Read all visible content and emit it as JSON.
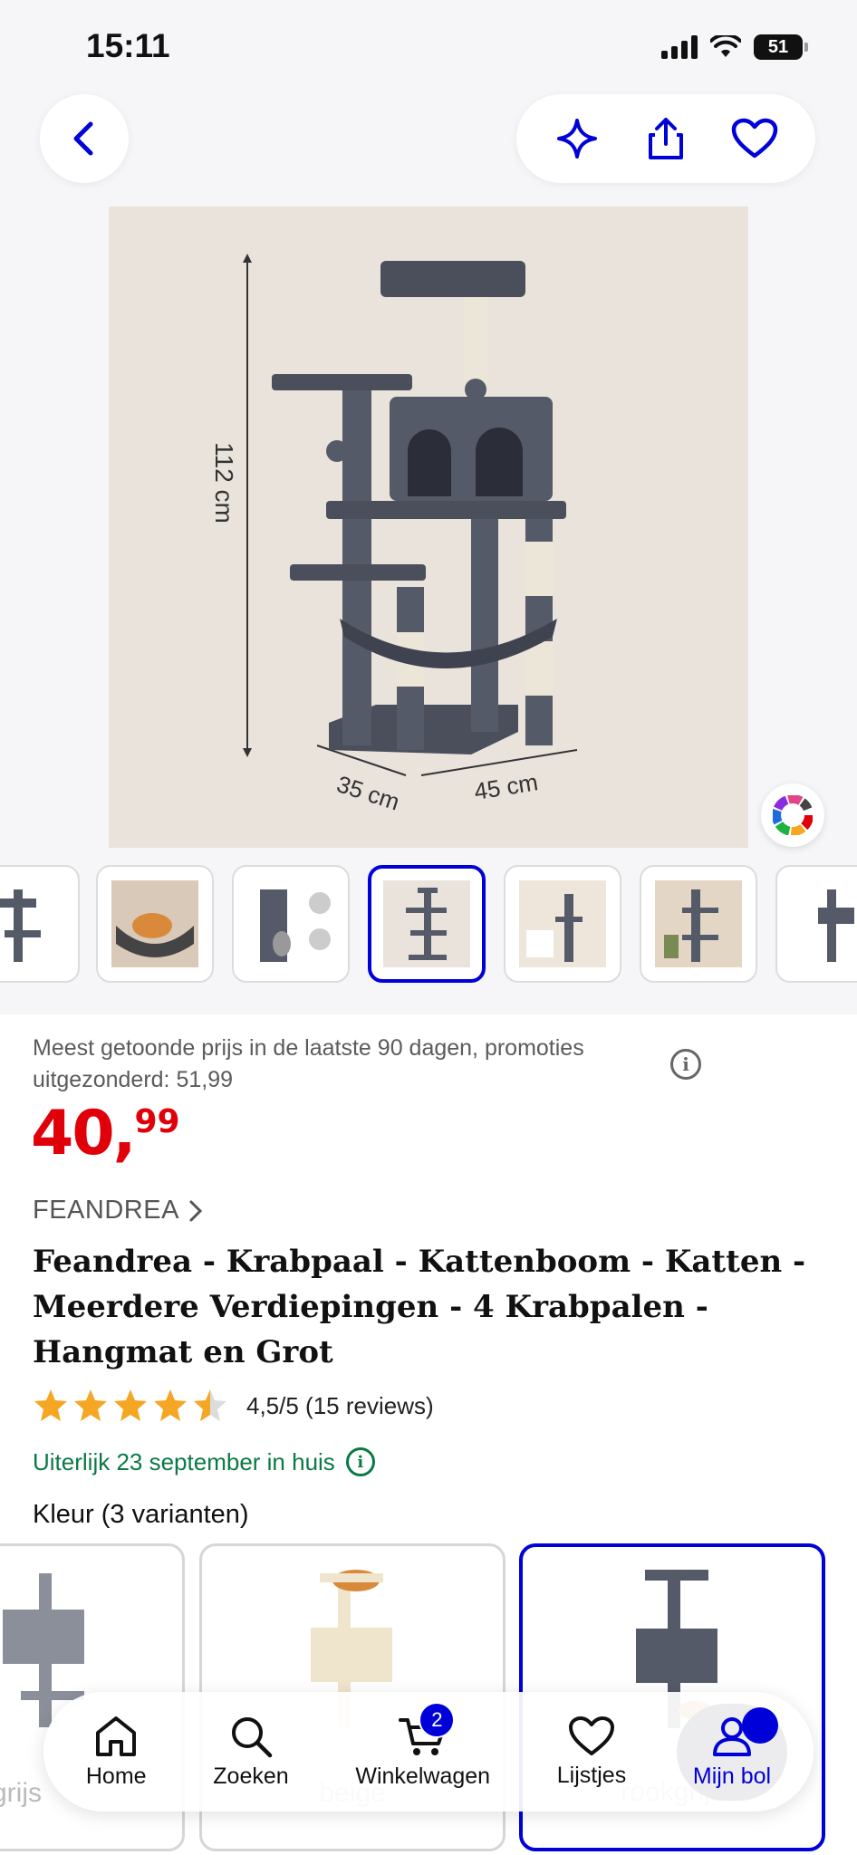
{
  "status_bar": {
    "time": "15:11",
    "battery": "51"
  },
  "nav": {
    "back_icon": "chevron-left-icon",
    "actions": [
      "sparkle-icon",
      "share-icon",
      "heart-icon"
    ]
  },
  "product_image": {
    "height_label": "112 cm",
    "depth_label": "35 cm",
    "width_label": "45 cm"
  },
  "thumbnails": {
    "count": 7,
    "active_index": 3
  },
  "price_block": {
    "note": "Meest getoonde prijs in de laatste 90 dagen, promoties uitgezonderd: 51,99",
    "price_euros": "40,",
    "price_cents": "99"
  },
  "product": {
    "brand": "FEANDREA",
    "title": "Feandrea - Krabpaal - Kattenboom - Katten - Meerdere Verdiepingen - 4 Krabpalen - Hangmat en Grot",
    "rating_value": 4.5,
    "rating_text": "4,5/5 (15 reviews)",
    "delivery": "Uiterlijk 23 september in huis"
  },
  "variants": {
    "label": "Kleur (3 varianten)",
    "items": [
      {
        "name": "grijs"
      },
      {
        "name": "beige"
      },
      {
        "name": "rookgrijs"
      }
    ]
  },
  "tabbar": {
    "items": [
      {
        "label": "Home",
        "icon": "home-icon"
      },
      {
        "label": "Zoeken",
        "icon": "search-icon"
      },
      {
        "label": "Winkelwagen",
        "icon": "cart-icon",
        "badge": "2"
      },
      {
        "label": "Lijstjes",
        "icon": "heart-icon"
      },
      {
        "label": "Mijn bol",
        "icon": "user-icon",
        "active": true
      }
    ]
  },
  "colors": {
    "accent": "#0000d8",
    "price": "#e0000a",
    "delivery": "#0a7a44",
    "star": "#f5a623"
  }
}
